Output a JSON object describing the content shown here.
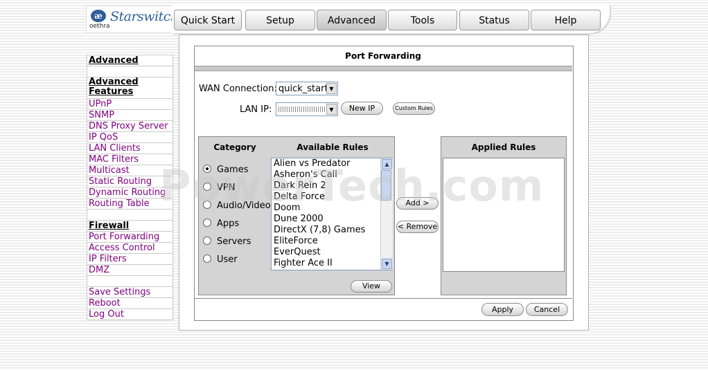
{
  "brand": {
    "mark": "æ",
    "company": "oethra",
    "product": "Starswitch"
  },
  "tabs": [
    {
      "label": "Quick Start"
    },
    {
      "label": "Setup"
    },
    {
      "label": "Advanced"
    },
    {
      "label": "Tools"
    },
    {
      "label": "Status"
    },
    {
      "label": "Help"
    }
  ],
  "sidebar": {
    "advanced_head": "Advanced",
    "features_head": "Advanced Features",
    "features": [
      "UPnP",
      "SNMP",
      "DNS Proxy Server",
      "IP QoS",
      "LAN Clients",
      "MAC Filters",
      "Multicast",
      "Static Routing",
      "Dynamic Routing",
      "Routing Table"
    ],
    "firewall_head": "Firewall",
    "firewall": [
      "Port Forwarding",
      "Access Control",
      "IP Filters",
      "DMZ"
    ],
    "actions": [
      "Save Settings",
      "Reboot",
      "Log Out"
    ]
  },
  "page": {
    "title": "Port Forwarding",
    "wan_label": "WAN Connection:",
    "wan_value": "quick_start",
    "lan_label": "LAN IP:",
    "new_ip": "New IP",
    "custom_rules": "Custom Rules",
    "category_head": "Category",
    "available_head": "Available Rules",
    "applied_head": "Applied Rules",
    "categories": [
      "Games",
      "VPN",
      "Audio/Video",
      "Apps",
      "Servers",
      "User"
    ],
    "selected_category": "Games",
    "rules": [
      "Alien vs Predator",
      "Asheron's Call",
      "Dark Rein 2",
      "Delta Force",
      "Doom",
      "Dune 2000",
      "DirectX (7,8) Games",
      "EliteForce",
      "EverQuest",
      "Fighter Ace II"
    ],
    "add": "Add >",
    "remove": "< Remove",
    "view": "View",
    "apply": "Apply",
    "cancel": "Cancel"
  },
  "watermark": "PowerTech.com"
}
